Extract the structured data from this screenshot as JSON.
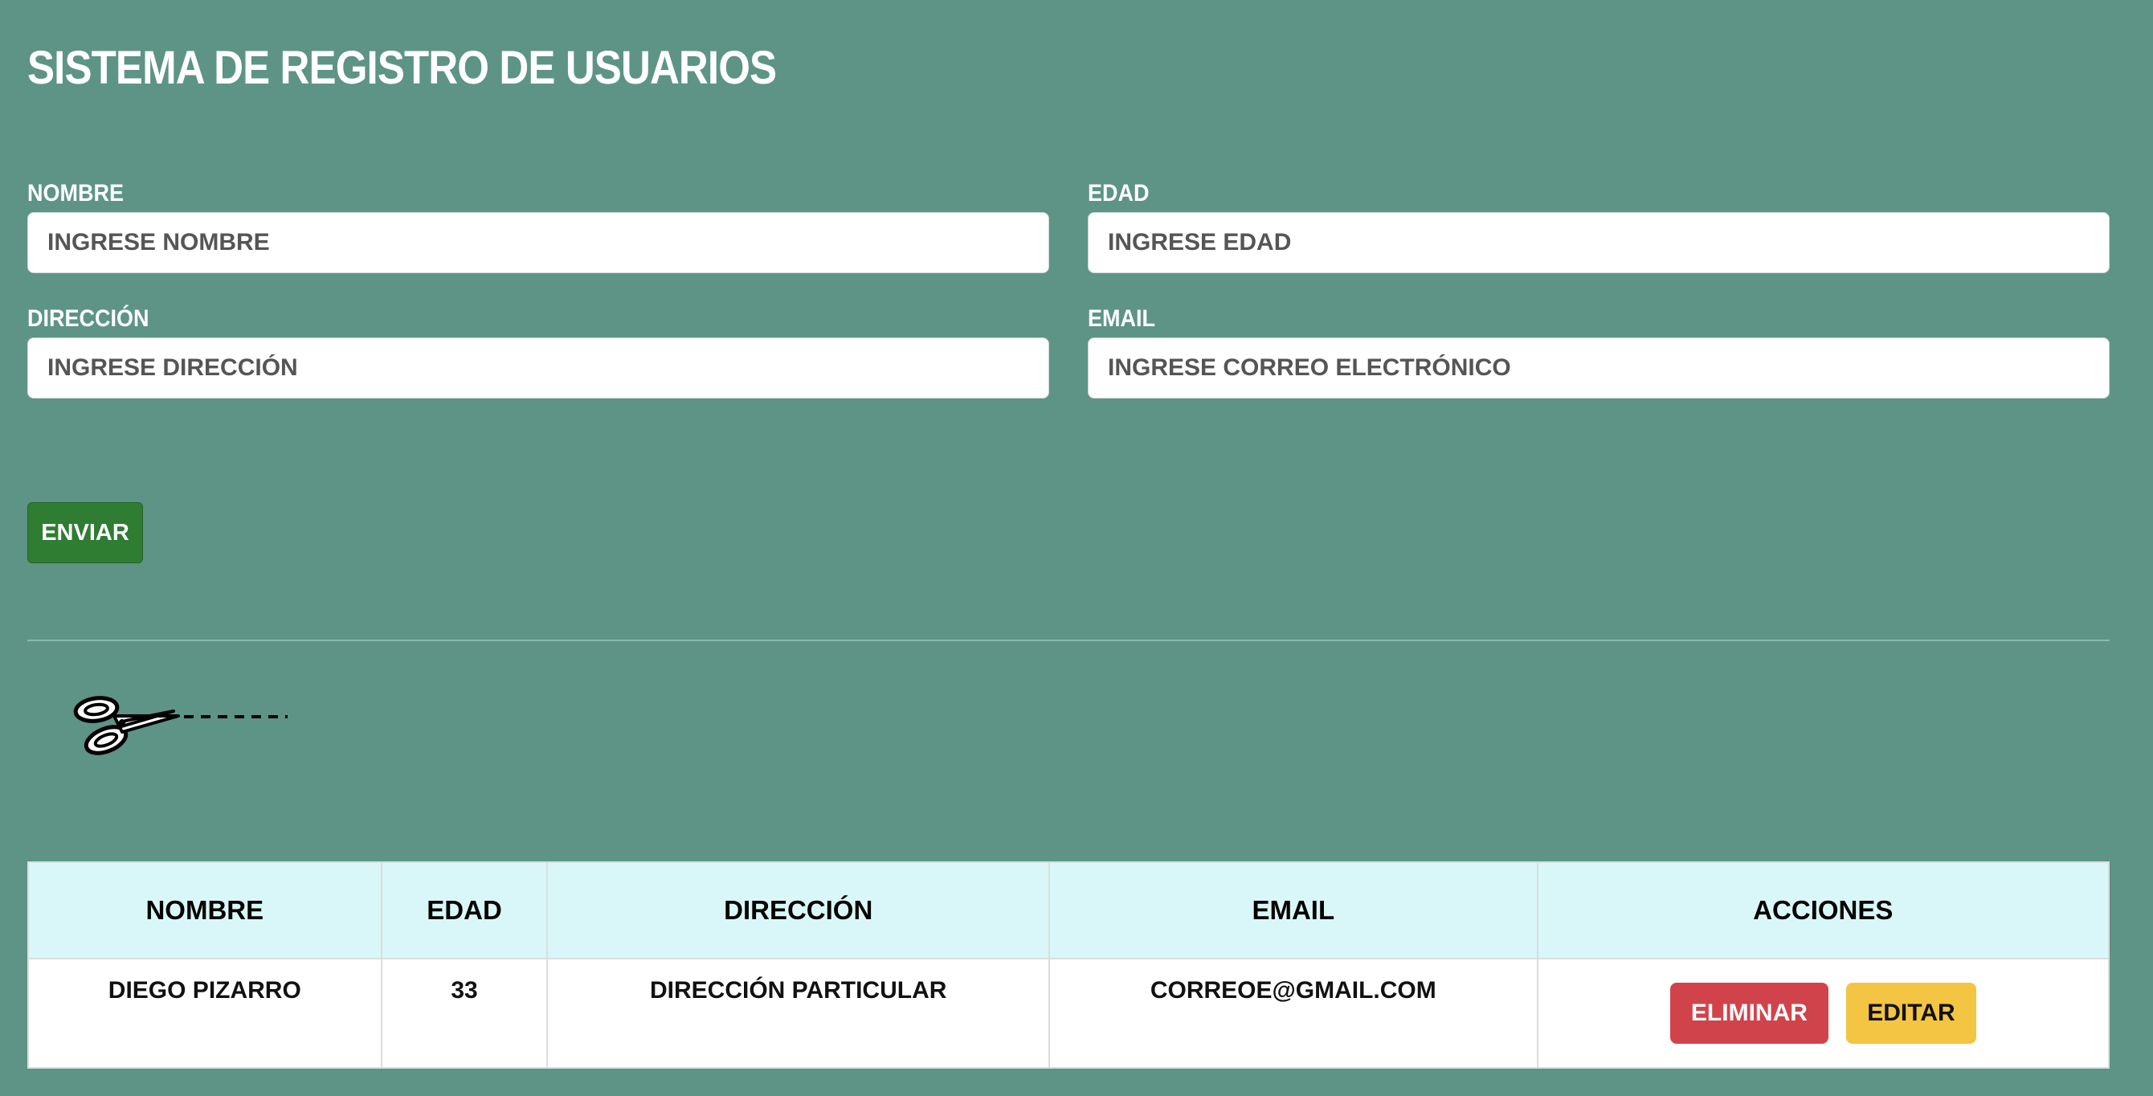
{
  "header": {
    "title": "SISTEMA DE REGISTRO DE USUARIOS"
  },
  "form": {
    "nombre": {
      "label": "NOMBRE",
      "placeholder": "INGRESE NOMBRE",
      "value": ""
    },
    "edad": {
      "label": "EDAD",
      "placeholder": "INGRESE EDAD",
      "value": ""
    },
    "direccion": {
      "label": "DIRECCIÓN",
      "placeholder": "INGRESE DIRECCIÓN",
      "value": ""
    },
    "email": {
      "label": "EMAIL",
      "placeholder": "INGRESE CORREO ELECTRÓNICO",
      "value": ""
    },
    "submit_label": "ENVIAR"
  },
  "table": {
    "headers": [
      "NOMBRE",
      "EDAD",
      "DIRECCIÓN",
      "EMAIL",
      "ACCIONES"
    ],
    "rows": [
      {
        "nombre": "DIEGO PIZARRO",
        "edad": "33",
        "direccion": "DIRECCIÓN PARTICULAR",
        "email": "CORREOE@GMAIL.COM",
        "delete_label": "ELIMINAR",
        "edit_label": "EDITAR"
      }
    ]
  },
  "colors": {
    "background": "#5d9486",
    "submit": "#2e7d32",
    "delete": "#d1434b",
    "edit": "#f4c542",
    "table_header": "#d9f7f8"
  },
  "icons": {
    "separator": "scissors-icon"
  }
}
